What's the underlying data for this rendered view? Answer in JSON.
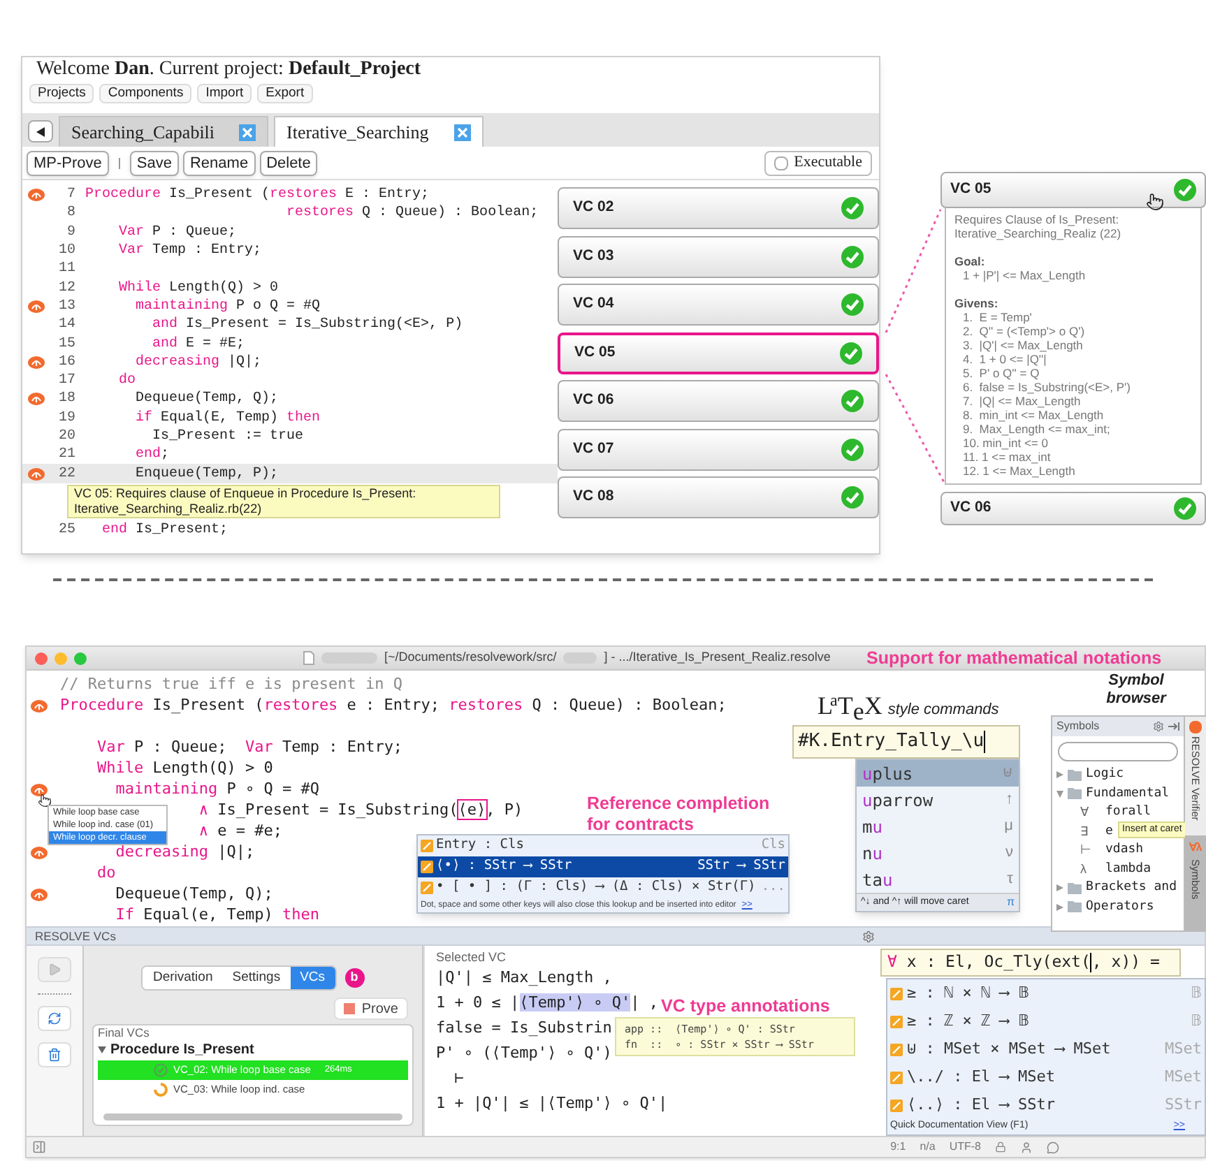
{
  "top_window": {
    "welcome": "Welcome **Dan**. Current project: **Default_Project**",
    "menu": [
      "Projects",
      "Components",
      "Import",
      "Export"
    ],
    "tabs": [
      {
        "label": "Searching_Capabili",
        "selected": false
      },
      {
        "label": "Iterative_Searching",
        "selected": true
      }
    ],
    "toolbar": [
      "MP-Prove",
      "Save",
      "Rename",
      "Delete"
    ],
    "executable": {
      "label": "Executable",
      "checked": false
    },
    "code": [
      {
        "kind": "line",
        "number": "7",
        "marker": true,
        "highlighted": false,
        "tokens": [
          {
            "kind": "keyword",
            "text": "Procedure"
          },
          {
            "kind": "plain",
            "text": " Is_Present ("
          },
          {
            "kind": "keyword",
            "text": "restores"
          },
          {
            "kind": "plain",
            "text": " E : Entry;"
          }
        ]
      },
      {
        "kind": "line",
        "number": "8",
        "marker": false,
        "highlighted": false,
        "tokens": [
          {
            "kind": "keyword",
            "text": "                        restores"
          },
          {
            "kind": "plain",
            "text": " Q : Queue) : Boolean;"
          }
        ]
      },
      {
        "kind": "line",
        "number": "9",
        "marker": false,
        "highlighted": false,
        "tokens": [
          {
            "kind": "keyword",
            "text": "    Var"
          },
          {
            "kind": "plain",
            "text": " P : Queue;"
          }
        ]
      },
      {
        "kind": "line",
        "number": "10",
        "marker": false,
        "highlighted": false,
        "tokens": [
          {
            "kind": "keyword",
            "text": "    Var"
          },
          {
            "kind": "plain",
            "text": " Temp : Entry;"
          }
        ]
      },
      {
        "kind": "line",
        "number": "11",
        "marker": false,
        "highlighted": false
      },
      {
        "kind": "line",
        "number": "12",
        "marker": false,
        "highlighted": false,
        "tokens": [
          {
            "kind": "keyword",
            "text": "    While"
          },
          {
            "kind": "plain",
            "text": " Length(Q) > 0"
          }
        ]
      },
      {
        "kind": "line",
        "number": "13",
        "marker": true,
        "highlighted": false,
        "tokens": [
          {
            "kind": "keyword",
            "text": "      maintaining"
          },
          {
            "kind": "plain",
            "text": " P o Q = #Q"
          }
        ]
      },
      {
        "kind": "line",
        "number": "14",
        "marker": false,
        "highlighted": false,
        "tokens": [
          {
            "kind": "keyword",
            "text": "        and"
          },
          {
            "kind": "plain",
            "text": " Is_Present = Is_Substring(<E>, P)"
          }
        ]
      },
      {
        "kind": "line",
        "number": "15",
        "marker": false,
        "highlighted": false,
        "tokens": [
          {
            "kind": "keyword",
            "text": "        and"
          },
          {
            "kind": "plain",
            "text": " E = #E;"
          }
        ]
      },
      {
        "kind": "line",
        "number": "16",
        "marker": true,
        "highlighted": false,
        "tokens": [
          {
            "kind": "keyword",
            "text": "      decreasing"
          },
          {
            "kind": "plain",
            "text": " |Q|;"
          }
        ]
      },
      {
        "kind": "line",
        "number": "17",
        "marker": false,
        "highlighted": false,
        "tokens": [
          {
            "kind": "keyword",
            "text": "    do"
          }
        ]
      },
      {
        "kind": "line",
        "number": "18",
        "marker": true,
        "highlighted": false,
        "tokens": [
          {
            "kind": "plain",
            "text": "      Dequeue(Temp, Q);"
          }
        ]
      },
      {
        "kind": "line",
        "number": "19",
        "marker": false,
        "highlighted": false,
        "tokens": [
          {
            "kind": "keyword",
            "text": "      if"
          },
          {
            "kind": "plain",
            "text": " Equal(E, Temp) "
          },
          {
            "kind": "keyword",
            "text": "then"
          }
        ]
      },
      {
        "kind": "line",
        "number": "20",
        "marker": false,
        "highlighted": false,
        "tokens": [
          {
            "kind": "plain",
            "text": "        Is_Present := true"
          }
        ]
      },
      {
        "kind": "line",
        "number": "21",
        "marker": false,
        "highlighted": false,
        "tokens": [
          {
            "kind": "keyword",
            "text": "      end"
          },
          {
            "kind": "plain",
            "text": ";"
          }
        ]
      },
      {
        "kind": "line",
        "number": "22",
        "marker": true,
        "highlighted": true,
        "tokens": [
          {
            "kind": "plain",
            "text": "      Enqueue(Temp, P);"
          }
        ]
      },
      {
        "kind": "tooltip",
        "text": "VC 05: Requires clause of Enqueue in Procedure Is_Present: Iterative_Searching_Realiz.rb(22)"
      },
      {
        "kind": "line",
        "number": "25",
        "marker": false,
        "highlighted": false,
        "tokens": [
          {
            "kind": "keyword",
            "text": "  end"
          },
          {
            "kind": "plain",
            "text": " Is_Present;"
          }
        ]
      }
    ],
    "vcs": [
      {
        "label": "VC 02",
        "proved": true,
        "selected": false
      },
      {
        "label": "VC 03",
        "proved": true,
        "selected": false
      },
      {
        "label": "VC 04",
        "proved": true,
        "selected": false
      },
      {
        "label": "VC 05",
        "proved": true,
        "selected": true
      },
      {
        "label": "VC 06",
        "proved": true,
        "selected": false
      },
      {
        "label": "VC 07",
        "proved": true,
        "selected": false
      },
      {
        "label": "VC 08",
        "proved": true,
        "selected": false
      }
    ]
  },
  "vc_detail": {
    "title": "VC 05",
    "proved": true,
    "description": "Requires Clause of Is_Present: Iterative_Searching_Realiz (22)",
    "goal_heading": "Goal:",
    "goal": "1 + |P'| <= Max_Length",
    "givens_heading": "Givens:",
    "givens": [
      "1.  E = Temp'",
      "2.  Q'' = (<Temp'> o Q')",
      "3.  |Q'| <= Max_Length",
      "4.  1 + 0 <= |Q''|",
      "5.  P' o Q'' = Q",
      "6.  false = Is_Substring(<E>, P')",
      "7.  |Q| <= Max_Length",
      "8.  min_int <= Max_Length",
      "9.  Max_Length <= max_int;",
      "10. min_int <= 0",
      "11. 1 <= max_int",
      "12. 1 <= Max_Length"
    ]
  },
  "next_vc": {
    "title": "VC 06",
    "proved": true
  },
  "ide": {
    "title_path": "[~/Documents/resolvework/src/",
    "title_file": "] - .../Iterative_Is_Present_Realiz.resolve",
    "code": [
      {
        "marker": false,
        "tokens": [
          {
            "kind": "comment",
            "text": "// Returns true iff e is present in Q"
          }
        ]
      },
      {
        "marker": true,
        "tokens": [
          {
            "kind": "keyword",
            "text": "Procedure"
          },
          {
            "kind": "plain",
            "text": " Is_Present ("
          },
          {
            "kind": "keyword",
            "text": "restores"
          },
          {
            "kind": "plain",
            "text": " e : Entry; "
          },
          {
            "kind": "keyword",
            "text": "restores"
          },
          {
            "kind": "plain",
            "text": " Q : Queue) : Boolean;"
          }
        ]
      },
      {
        "marker": false
      },
      {
        "marker": false,
        "tokens": [
          {
            "kind": "keyword",
            "text": "    Var"
          },
          {
            "kind": "plain",
            "text": " P : Queue;  "
          },
          {
            "kind": "keyword",
            "text": "Var"
          },
          {
            "kind": "plain",
            "text": " Temp : Entry;"
          }
        ]
      },
      {
        "marker": false,
        "tokens": [
          {
            "kind": "keyword",
            "text": "    While"
          },
          {
            "kind": "plain",
            "text": " Length(Q) > 0"
          }
        ]
      },
      {
        "marker": true,
        "tokens": [
          {
            "kind": "keyword",
            "text": "      maintaining"
          },
          {
            "kind": "plain",
            "text": " P ∘ Q = #Q"
          }
        ]
      },
      {
        "marker": false,
        "tokens": [
          {
            "kind": "keyword",
            "text": "               ∧"
          },
          {
            "kind": "plain",
            "text": " Is_Present = Is_Substring("
          },
          {
            "kind": "boxed",
            "text": "⟨e⟩"
          },
          {
            "kind": "plain",
            "text": ", P)"
          }
        ]
      },
      {
        "marker": false,
        "tokens": [
          {
            "kind": "keyword",
            "text": "               ∧"
          },
          {
            "kind": "plain",
            "text": " e = #e;"
          }
        ]
      },
      {
        "marker": true,
        "tokens": [
          {
            "kind": "keyword",
            "text": "      decreasing"
          },
          {
            "kind": "plain",
            "text": " |Q|;"
          }
        ]
      },
      {
        "marker": false,
        "tokens": [
          {
            "kind": "keyword",
            "text": "    do"
          }
        ]
      },
      {
        "marker": true,
        "tokens": [
          {
            "kind": "plain",
            "text": "      Dequeue(Temp, Q);"
          }
        ]
      },
      {
        "marker": false,
        "tokens": [
          {
            "kind": "keyword",
            "text": "      If"
          },
          {
            "kind": "plain",
            "text": " Equal(e, Temp) "
          },
          {
            "kind": "keyword",
            "text": "then"
          }
        ]
      }
    ],
    "gutter_menu": [
      {
        "label": "While loop base case",
        "selected": false
      },
      {
        "label": "While loop ind. case (01)",
        "selected": false
      },
      {
        "label": "While loop decr. clause",
        "selected": true
      }
    ],
    "ref_label": "Reference completion for contracts",
    "ref_popup": {
      "rows": [
        {
          "name": "Entry : Cls",
          "type": "Cls",
          "selected": false
        },
        {
          "name": "⟨•⟩ : SStr ⟶ SStr",
          "type": "SStr ⟶ SStr",
          "selected": true
        },
        {
          "name": "• [ • ] : (Γ : Cls) ⟶ (Δ : Cls) × Str(Γ)",
          "type": "...",
          "selected": false
        }
      ],
      "footer": "Dot, space and some other keys will also close this lookup and be inserted into editor",
      "link": ">>"
    },
    "notation_label": "Support for mathematical notations",
    "latex_logo": "LaTeX",
    "latex_caption": "style commands",
    "latex_input": "#K.Entry_Tally_\\u",
    "latex_completions": [
      {
        "match": "u",
        "after": "plus",
        "symbol": "⊎",
        "selected": true
      },
      {
        "match": "u",
        "after": "parrow",
        "symbol": "↑",
        "selected": false
      },
      {
        "before": "m",
        "match": "u",
        "symbol": "μ",
        "selected": false
      },
      {
        "before": "n",
        "match": "u",
        "symbol": "ν",
        "selected": false
      },
      {
        "before": "ta",
        "match": "u",
        "symbol": "τ",
        "selected": false
      }
    ],
    "latex_hint": "^↓ and ^↑ will move caret",
    "latex_hint_icon": "π",
    "symbol_browser_label": "Symbol browser",
    "symbols": {
      "title": "Symbols",
      "tooltip": "Insert at caret",
      "tree": [
        {
          "label": "Logic",
          "expanded": false
        },
        {
          "label": "Fundamental",
          "expanded": true,
          "children": [
            {
              "symbol": "∀",
              "label": "forall"
            },
            {
              "symbol": "∃",
              "label": "e"
            },
            {
              "symbol": "⊢",
              "label": "vdash"
            },
            {
              "symbol": "λ",
              "label": "lambda"
            }
          ]
        },
        {
          "label": "Brackets and",
          "expanded": false
        },
        {
          "label": "Operators",
          "expanded": false
        }
      ]
    },
    "side_tabs": [
      {
        "label": "RESOLVE Verifier",
        "selected": false
      },
      {
        "label": "Symbols",
        "glyph": "∀λ",
        "selected": true
      }
    ],
    "panel_title": "RESOLVE VCs",
    "vc_tabs": [
      {
        "label": "Derivation",
        "selected": false
      },
      {
        "label": "Settings",
        "selected": false
      },
      {
        "label": "VCs",
        "selected": true
      }
    ],
    "badge": "b",
    "prove": "Prove",
    "final_vcs": "Final VCs",
    "procedure": "Procedure Is_Present",
    "vcs": [
      {
        "label": "VC_02: While loop base case",
        "time": "264ms",
        "proved": true,
        "selected": true
      },
      {
        "label": "VC_03: While loop ind. case",
        "proved": false,
        "selected": false
      }
    ],
    "selected_vc_title": "Selected VC",
    "selected_vc": [
      [
        {
          "kind": "plain",
          "text": "|Q'| ≤ Max_Length ,"
        }
      ],
      [
        {
          "kind": "plain",
          "text": "1 + 0 ≤ |"
        },
        {
          "kind": "highlight",
          "text": "⟨Temp'⟩ ∘ Q'"
        },
        {
          "kind": "plain",
          "text": "| ,"
        }
      ],
      [
        {
          "kind": "plain",
          "text": "false = Is_Substrin"
        }
      ],
      [
        {
          "kind": "plain",
          "text": "P' ∘ (⟨Temp'⟩ ∘ Q')"
        }
      ],
      [
        {
          "kind": "plain",
          "text": "  ⊢"
        }
      ],
      [
        {
          "kind": "plain",
          "text": "1 + |Q'| ≤ |⟨Temp'⟩ ∘ Q'|"
        }
      ]
    ],
    "vc_type_label": "VC type annotations",
    "type_tooltip": [
      "app ::  ⟨Temp'⟩ ∘ Q' : SStr",
      "fn  ::  ∘ : SStr × SStr ⟶ SStr"
    ],
    "formula_input": {
      "before": [
        {
          "kind": "keyword",
          "text": "∀"
        },
        {
          "kind": "plain",
          "text": " x : El, Oc_Tly(ext("
        }
      ],
      "after": [
        {
          "kind": "plain",
          "text": ", x)) ="
        }
      ]
    },
    "formula_completions": [
      {
        "name": "≥ : ℕ × ℕ ⟶ 𝔹",
        "type": "𝔹"
      },
      {
        "name": "≥ : ℤ × ℤ ⟶ 𝔹",
        "type": "𝔹"
      },
      {
        "name": "⊎ : MSet × MSet ⟶ MSet",
        "type": "MSet"
      },
      {
        "name": "\\../ : El ⟶ MSet",
        "type": "MSet"
      },
      {
        "name": "⟨..⟩ : El ⟶ SStr",
        "type": "SStr"
      }
    ],
    "formula_footer": "Quick Documentation View (F1)",
    "formula_link": ">>",
    "status_bar": [
      "9:1",
      "n/a",
      "UTF-8"
    ]
  }
}
